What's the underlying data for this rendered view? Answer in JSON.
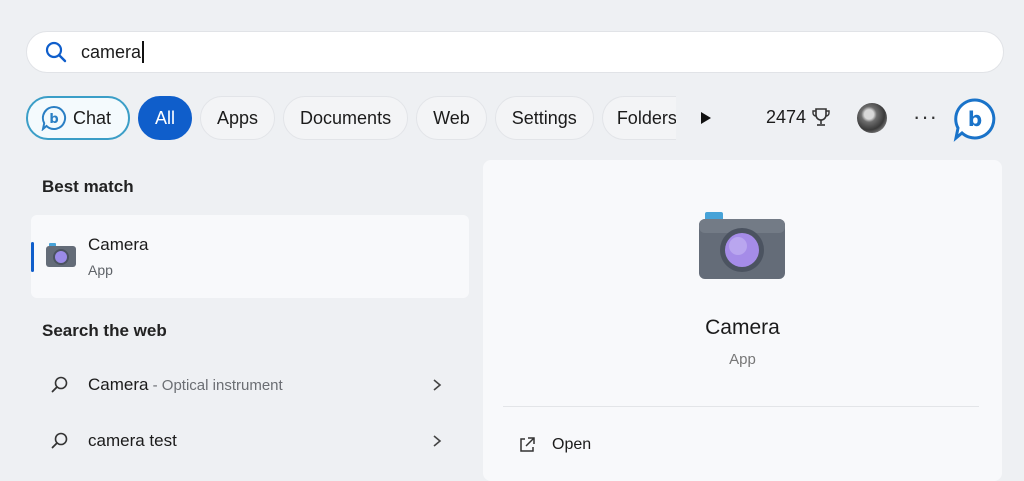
{
  "search": {
    "query": "camera"
  },
  "filters": {
    "chat": "Chat",
    "all": "All",
    "apps": "Apps",
    "documents": "Documents",
    "web": "Web",
    "settings": "Settings",
    "folders": "Folders"
  },
  "toolbar": {
    "points": "2474",
    "more": "···",
    "icons": [
      "play-icon",
      "trophy-icon",
      "avatar",
      "bing-icon"
    ]
  },
  "best_match": {
    "heading": "Best match",
    "title": "Camera",
    "subtitle": "App"
  },
  "web_search": {
    "heading": "Search the web",
    "items": [
      {
        "label": "Camera",
        "sub": " - Optical instrument"
      },
      {
        "label": "camera test",
        "sub": ""
      }
    ]
  },
  "detail": {
    "title": "Camera",
    "subtitle": "App",
    "actions": [
      {
        "label": "Open",
        "icon": "open-external-icon"
      }
    ]
  },
  "colors": {
    "accent": "#0f5ecb",
    "chat_border": "#3b9ec7",
    "background": "#eef0f3",
    "panel": "#f8f9fb"
  }
}
